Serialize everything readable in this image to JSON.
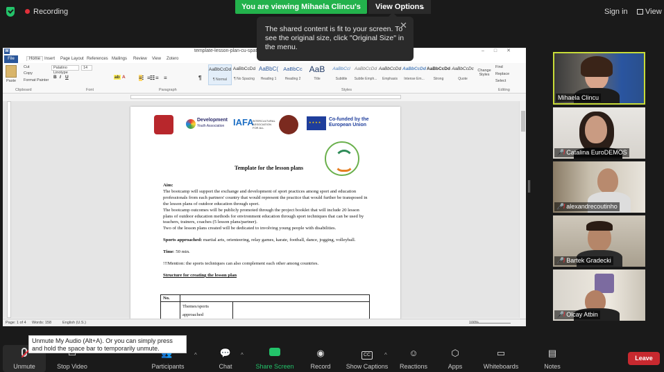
{
  "topbar": {
    "recording_label": "Recording",
    "viewing_banner": "You are viewing Mihaela Clincu's screen",
    "view_options_label": "View Options",
    "sign_in_label": "Sign in",
    "view_label": "View"
  },
  "tooltip": {
    "text": "The shared content is fit to your screen. To see the original size, click \"Original Size\" in the menu."
  },
  "word": {
    "window_title": "template-lesson-plan-cu-spatiu",
    "tabs": [
      "File",
      "Home",
      "Insert",
      "Page Layout",
      "References",
      "Mailings",
      "Review",
      "View",
      "Zotero"
    ],
    "clipboard": {
      "paste": "Paste",
      "cut": "Cut",
      "copy": "Copy",
      "format_painter": "Format Painter",
      "group": "Clipboard"
    },
    "font": {
      "family": "Palatino Linotype",
      "size": "14",
      "group": "Font"
    },
    "paragraph_group": "Paragraph",
    "styles_group": "Styles",
    "editing_group": "Editing",
    "styles": [
      {
        "sample": "AaBbCcDd",
        "name": "¶ Normal"
      },
      {
        "sample": "AaBbCcDd",
        "name": "¶ No Spacing"
      },
      {
        "sample": "AaBbC(",
        "name": "Heading 1"
      },
      {
        "sample": "AaBbCc",
        "name": "Heading 2"
      },
      {
        "sample": "AaB",
        "name": "Title"
      },
      {
        "sample": "AaBbCcl",
        "name": "Subtitle"
      },
      {
        "sample": "AaBbCcDd",
        "name": "Subtle Emph..."
      },
      {
        "sample": "AaBbCcDd",
        "name": "Emphasis"
      },
      {
        "sample": "AaBbCcDd",
        "name": "Intense Em..."
      },
      {
        "sample": "AaBbCcDd",
        "name": "Strong"
      },
      {
        "sample": "AaBbCcDc",
        "name": "Quote"
      }
    ],
    "change_styles": "Change Styles",
    "editing": {
      "find": "Find",
      "replace": "Replace",
      "select": "Select"
    },
    "status": {
      "page": "Page: 1 of 4",
      "words": "Words: 158",
      "language": "English (U.S.)",
      "zoom": "100%"
    }
  },
  "document": {
    "logos": {
      "development_line1": "Development",
      "development_line2": "Youth Association",
      "iafa": "IAFA",
      "iafa_sub": "INTERCULTURAL ASSOCIATION FOR ALL",
      "eu": "Co-funded by the European Union"
    },
    "title": "Template for the lesson plans",
    "aim_label": "Aim:",
    "aim_text": "The bootcamp will support the exchange and development of sport practices among sport and education professionals from each partners' country that would represent the practice that would further be transposed in the lesson plans of outdoor education through sport.",
    "outcomes_text": "The bootcamp outcomes will be publicly promoted through the project booklet that will include 20 lesson plans of outdoor education methods for environment education through sport techniques that can be used by teachers, trainers, coaches (5 lesson plans/partner).",
    "disabilities_text": "Two of the lesson plans created will be dedicated to involving young people with disabilities.",
    "sports_label": "Sports approached:",
    "sports_text": " martial arts, orienteering, relay games, karate, football, dance, jogging, volleyball.",
    "time_label": "Time",
    "time_text": ": 50 min.",
    "mention_text": "!!!Mention: the sports techniques can also complement each other among countries.",
    "structure_label": "Structure for creating the lesson plan",
    "table": {
      "header_no": "No.",
      "row1_col2": "Themes/sports approached"
    }
  },
  "participants": [
    {
      "name": "Mihaela Clincu",
      "muted": false
    },
    {
      "name": "Catalina EuroDEMOS",
      "muted": true
    },
    {
      "name": "alexandrecoutinho",
      "muted": true
    },
    {
      "name": "Bartek Gradecki",
      "muted": true
    },
    {
      "name": "Olcay Atbin",
      "muted": true
    }
  ],
  "toolbar": {
    "unmute": "Unmute",
    "stop_video": "Stop Video",
    "participants": "Participants",
    "participants_count": "5",
    "chat": "Chat",
    "share_screen": "Share Screen",
    "record": "Record",
    "show_captions": "Show Captions",
    "captions_icon": "CC",
    "reactions": "Reactions",
    "apps": "Apps",
    "whiteboards": "Whiteboards",
    "notes": "Notes",
    "leave": "Leave",
    "unmute_tip": "Unmute My Audio (Alt+A). Or you can simply press and hold the space bar to temporarily unmute."
  },
  "colors": {
    "accent_green": "#23b24c",
    "leave_red": "#c8292f",
    "active_speaker": "#c8dc38"
  }
}
